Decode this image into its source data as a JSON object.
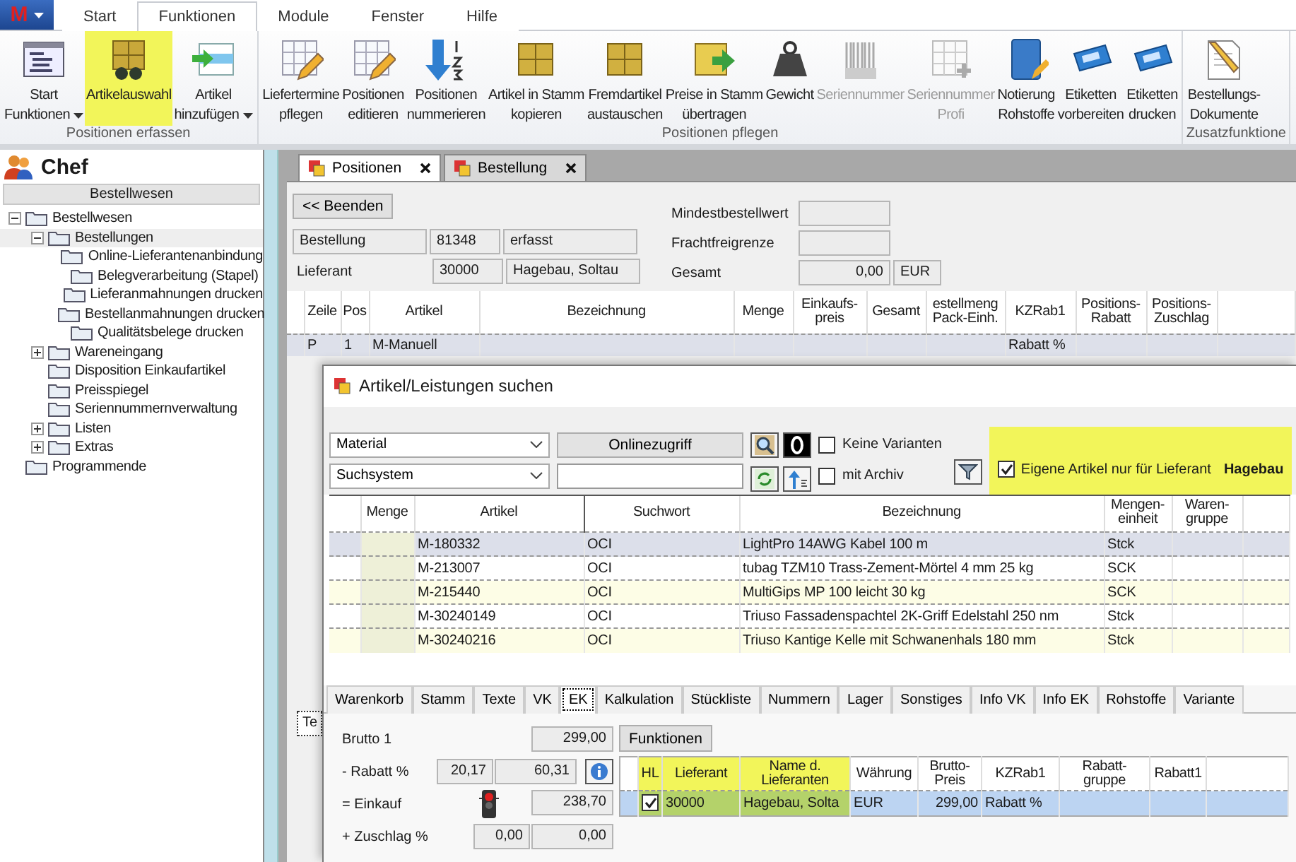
{
  "app_button": {
    "label": "M"
  },
  "menu_tabs": [
    {
      "label": "Start",
      "selected": false
    },
    {
      "label": "Funktionen",
      "selected": true
    },
    {
      "label": "Module",
      "selected": false
    },
    {
      "label": "Fenster",
      "selected": false
    },
    {
      "label": "Hilfe",
      "selected": false
    }
  ],
  "ribbon": [
    {
      "title": "Positionen erfassen",
      "buttons": [
        {
          "kind": "list",
          "lines": [
            "Start",
            "Funktionen"
          ],
          "dropdown": true,
          "highlighted": false,
          "disabled": false
        },
        {
          "kind": "crate-binoculars",
          "lines": [
            "Artikelauswahl"
          ],
          "dropdown": false,
          "highlighted": true,
          "disabled": false
        },
        {
          "kind": "grid-arrow",
          "lines": [
            "Artikel",
            "hinzufügen"
          ],
          "dropdown": true,
          "highlighted": false,
          "disabled": false
        }
      ]
    },
    {
      "title": "Positionen pflegen",
      "buttons": [
        {
          "kind": "grid-pencil",
          "lines": [
            "Liefertermine",
            "pflegen"
          ],
          "dropdown": false,
          "highlighted": false,
          "disabled": false
        },
        {
          "kind": "grid-pencil",
          "lines": [
            "Positionen",
            "editieren"
          ],
          "dropdown": false,
          "highlighted": false,
          "disabled": false
        },
        {
          "kind": "arrow-numbers",
          "lines": [
            "Positionen",
            "nummerieren"
          ],
          "dropdown": false,
          "highlighted": false,
          "disabled": false
        },
        {
          "kind": "crate",
          "lines": [
            "Artikel in Stamm",
            "kopieren"
          ],
          "dropdown": false,
          "highlighted": false,
          "disabled": false
        },
        {
          "kind": "crate",
          "lines": [
            "Fremdartikel",
            "austauschen"
          ],
          "dropdown": false,
          "highlighted": false,
          "disabled": false
        },
        {
          "kind": "crate-arrow",
          "lines": [
            "Preise in Stamm",
            "übertragen"
          ],
          "dropdown": false,
          "highlighted": false,
          "disabled": false
        },
        {
          "kind": "weight",
          "lines": [
            "Gewicht"
          ],
          "dropdown": false,
          "highlighted": false,
          "disabled": false
        },
        {
          "kind": "barcode",
          "lines": [
            "Seriennummer"
          ],
          "dropdown": false,
          "highlighted": false,
          "disabled": true
        },
        {
          "kind": "grid-plus",
          "lines": [
            "Seriennummer",
            "Profi"
          ],
          "dropdown": false,
          "highlighted": false,
          "disabled": true
        },
        {
          "kind": "book",
          "lines": [
            "Notierung",
            "Rohstoffe"
          ],
          "dropdown": false,
          "highlighted": false,
          "disabled": false
        },
        {
          "kind": "label",
          "lines": [
            "Etiketten",
            "vorbereiten"
          ],
          "dropdown": false,
          "highlighted": false,
          "disabled": false
        },
        {
          "kind": "label",
          "lines": [
            "Etiketten",
            "drucken"
          ],
          "dropdown": false,
          "highlighted": false,
          "disabled": false
        }
      ]
    },
    {
      "title": "Zusatzfunktione",
      "buttons": [
        {
          "kind": "document",
          "lines": [
            "Bestellungs-",
            "Dokumente"
          ],
          "dropdown": false,
          "highlighted": false,
          "disabled": false
        }
      ]
    }
  ],
  "sidebar": {
    "user": "Chef",
    "section": "Bestellwesen",
    "tree": [
      {
        "label": "Bestellwesen",
        "expanded": true,
        "selected": false,
        "children": [
          {
            "label": "Bestellungen",
            "expanded": true,
            "selected": true,
            "children": [
              {
                "label": "Online-Lieferantenanbindung",
                "selected": false
              },
              {
                "label": "Belegverarbeitung (Stapel)",
                "selected": false
              },
              {
                "label": "Lieferanmahnungen drucken",
                "selected": false
              },
              {
                "label": "Bestellanmahnungen drucken",
                "selected": false
              },
              {
                "label": "Qualitätsbelege drucken",
                "selected": false
              }
            ]
          },
          {
            "label": "Wareneingang",
            "expanded": false,
            "selected": false
          },
          {
            "label": "Disposition Einkaufartikel",
            "selected": false
          },
          {
            "label": "Preisspiegel",
            "selected": false
          },
          {
            "label": "Seriennummernverwaltung",
            "selected": false
          },
          {
            "label": "Listen",
            "expanded": false,
            "selected": false
          },
          {
            "label": "Extras",
            "expanded": false,
            "selected": false
          }
        ]
      },
      {
        "label": "Programmende",
        "selected": false
      }
    ]
  },
  "doc_tabs": [
    {
      "label": "Positionen",
      "selected": true
    },
    {
      "label": "Bestellung",
      "selected": false
    }
  ],
  "form": {
    "back_button": "<< Beenden",
    "order": {
      "label": "Bestellung",
      "number": "81348",
      "status": "erfasst"
    },
    "supplier": {
      "label": "Lieferant",
      "number": "30000",
      "name": "Hagebau, Soltau"
    },
    "min_order_label": "Mindestbestellwert",
    "freight_label": "Frachtfreigrenze",
    "total": {
      "label": "Gesamt",
      "value": "0,00",
      "currency": "EUR"
    }
  },
  "positions_grid": {
    "columns": [
      "Zeile",
      "Pos",
      "Artikel",
      "Bezeichnung",
      "Menge",
      "Einkaufs-\npreis",
      "Gesamt",
      "estellmeng\nPack-Einh.",
      "KZRab1",
      "Positions-\nRabatt",
      "Positions-\nZuschlag"
    ],
    "rows": [
      [
        "P",
        "1",
        "M-Manuell",
        null,
        null,
        null,
        null,
        null,
        "Rabatt %",
        null,
        null
      ]
    ]
  },
  "back_tab": "Te",
  "dialog": {
    "title": "Artikel/Leistungen suchen",
    "selects": [
      "Material",
      "Suchsystem"
    ],
    "online_button": "Onlinezugriff",
    "checkboxes": [
      {
        "label": "Keine Varianten",
        "checked": false
      },
      {
        "label": "mit Archiv",
        "checked": false
      }
    ],
    "own_articles": {
      "label": "Eigene Artikel nur für Lieferant",
      "supplier": "Hagebau",
      "checked": true,
      "highlighted": true
    },
    "table": {
      "columns": [
        "Menge",
        "Artikel",
        "Suchwort",
        "Bezeichnung",
        "Mengen-\neinheit",
        "Waren-\ngruppe"
      ],
      "rows": [
        {
          "selected": true,
          "cells": [
            null,
            "M-180332",
            "OCI",
            "LightPro 14AWG Kabel 100 m",
            "Stck",
            null
          ]
        },
        {
          "selected": false,
          "cells": [
            null,
            "M-213007",
            "OCI",
            "tubag TZM10 Trass-Zement-Mörtel 4 mm 25 kg",
            "SCK",
            null
          ]
        },
        {
          "selected": false,
          "cells": [
            null,
            "M-215440",
            "OCI",
            "MultiGips MP 100 leicht 30 kg",
            "SCK",
            null
          ]
        },
        {
          "selected": false,
          "cells": [
            null,
            "M-30240149",
            "OCI",
            "Triuso Fassadenspachtel 2K-Griff Edelstahl 250 nm",
            "Stck",
            null
          ]
        },
        {
          "selected": false,
          "cells": [
            null,
            "M-30240216",
            "OCI",
            "Triuso Kantige Kelle mit Schwanenhals 180 mm",
            "Stck",
            null
          ]
        }
      ]
    },
    "tabs": [
      {
        "label": "Warenkorb",
        "selected": false
      },
      {
        "label": "Stamm",
        "selected": false
      },
      {
        "label": "Texte",
        "selected": false
      },
      {
        "label": "VK",
        "selected": false
      },
      {
        "label": "EK",
        "selected": true
      },
      {
        "label": "Kalkulation",
        "selected": false
      },
      {
        "label": "Stückliste",
        "selected": false
      },
      {
        "label": "Nummern",
        "selected": false
      },
      {
        "label": "Lager",
        "selected": false
      },
      {
        "label": "Sonstiges",
        "selected": false
      },
      {
        "label": "Info VK",
        "selected": false
      },
      {
        "label": "Info EK",
        "selected": false
      },
      {
        "label": "Rohstoffe",
        "selected": false
      },
      {
        "label": "Variante",
        "selected": false
      }
    ],
    "prices": [
      {
        "label": "Brutto 1",
        "values": [
          "299,00"
        ]
      },
      {
        "label": "- Rabatt %",
        "values": [
          "20,17",
          "60,31"
        ]
      },
      {
        "label": "= Einkauf",
        "values": [
          "238,70"
        ]
      },
      {
        "label": "+ Zuschlag %",
        "values": [
          "0,00",
          "0,00"
        ]
      }
    ],
    "functions_button": "Funktionen",
    "supplier_table": {
      "columns": [
        {
          "label": "HL",
          "highlighted": true
        },
        {
          "label": "Lieferant",
          "highlighted": true
        },
        {
          "label": "Name d.\nLieferanten",
          "highlighted": true
        },
        {
          "label": "Währung",
          "highlighted": false
        },
        {
          "label": "Brutto-\nPreis",
          "highlighted": false
        },
        {
          "label": "KZRab1",
          "highlighted": false
        },
        {
          "label": "Rabatt-\ngruppe",
          "highlighted": false
        },
        {
          "label": "Rabatt1",
          "highlighted": false
        }
      ],
      "rows": [
        {
          "checked": true,
          "selected": true,
          "cells": [
            "",
            "30000",
            "Hagebau, Solta",
            "EUR",
            "299,00",
            "Rabatt %",
            null,
            null
          ]
        }
      ]
    }
  }
}
